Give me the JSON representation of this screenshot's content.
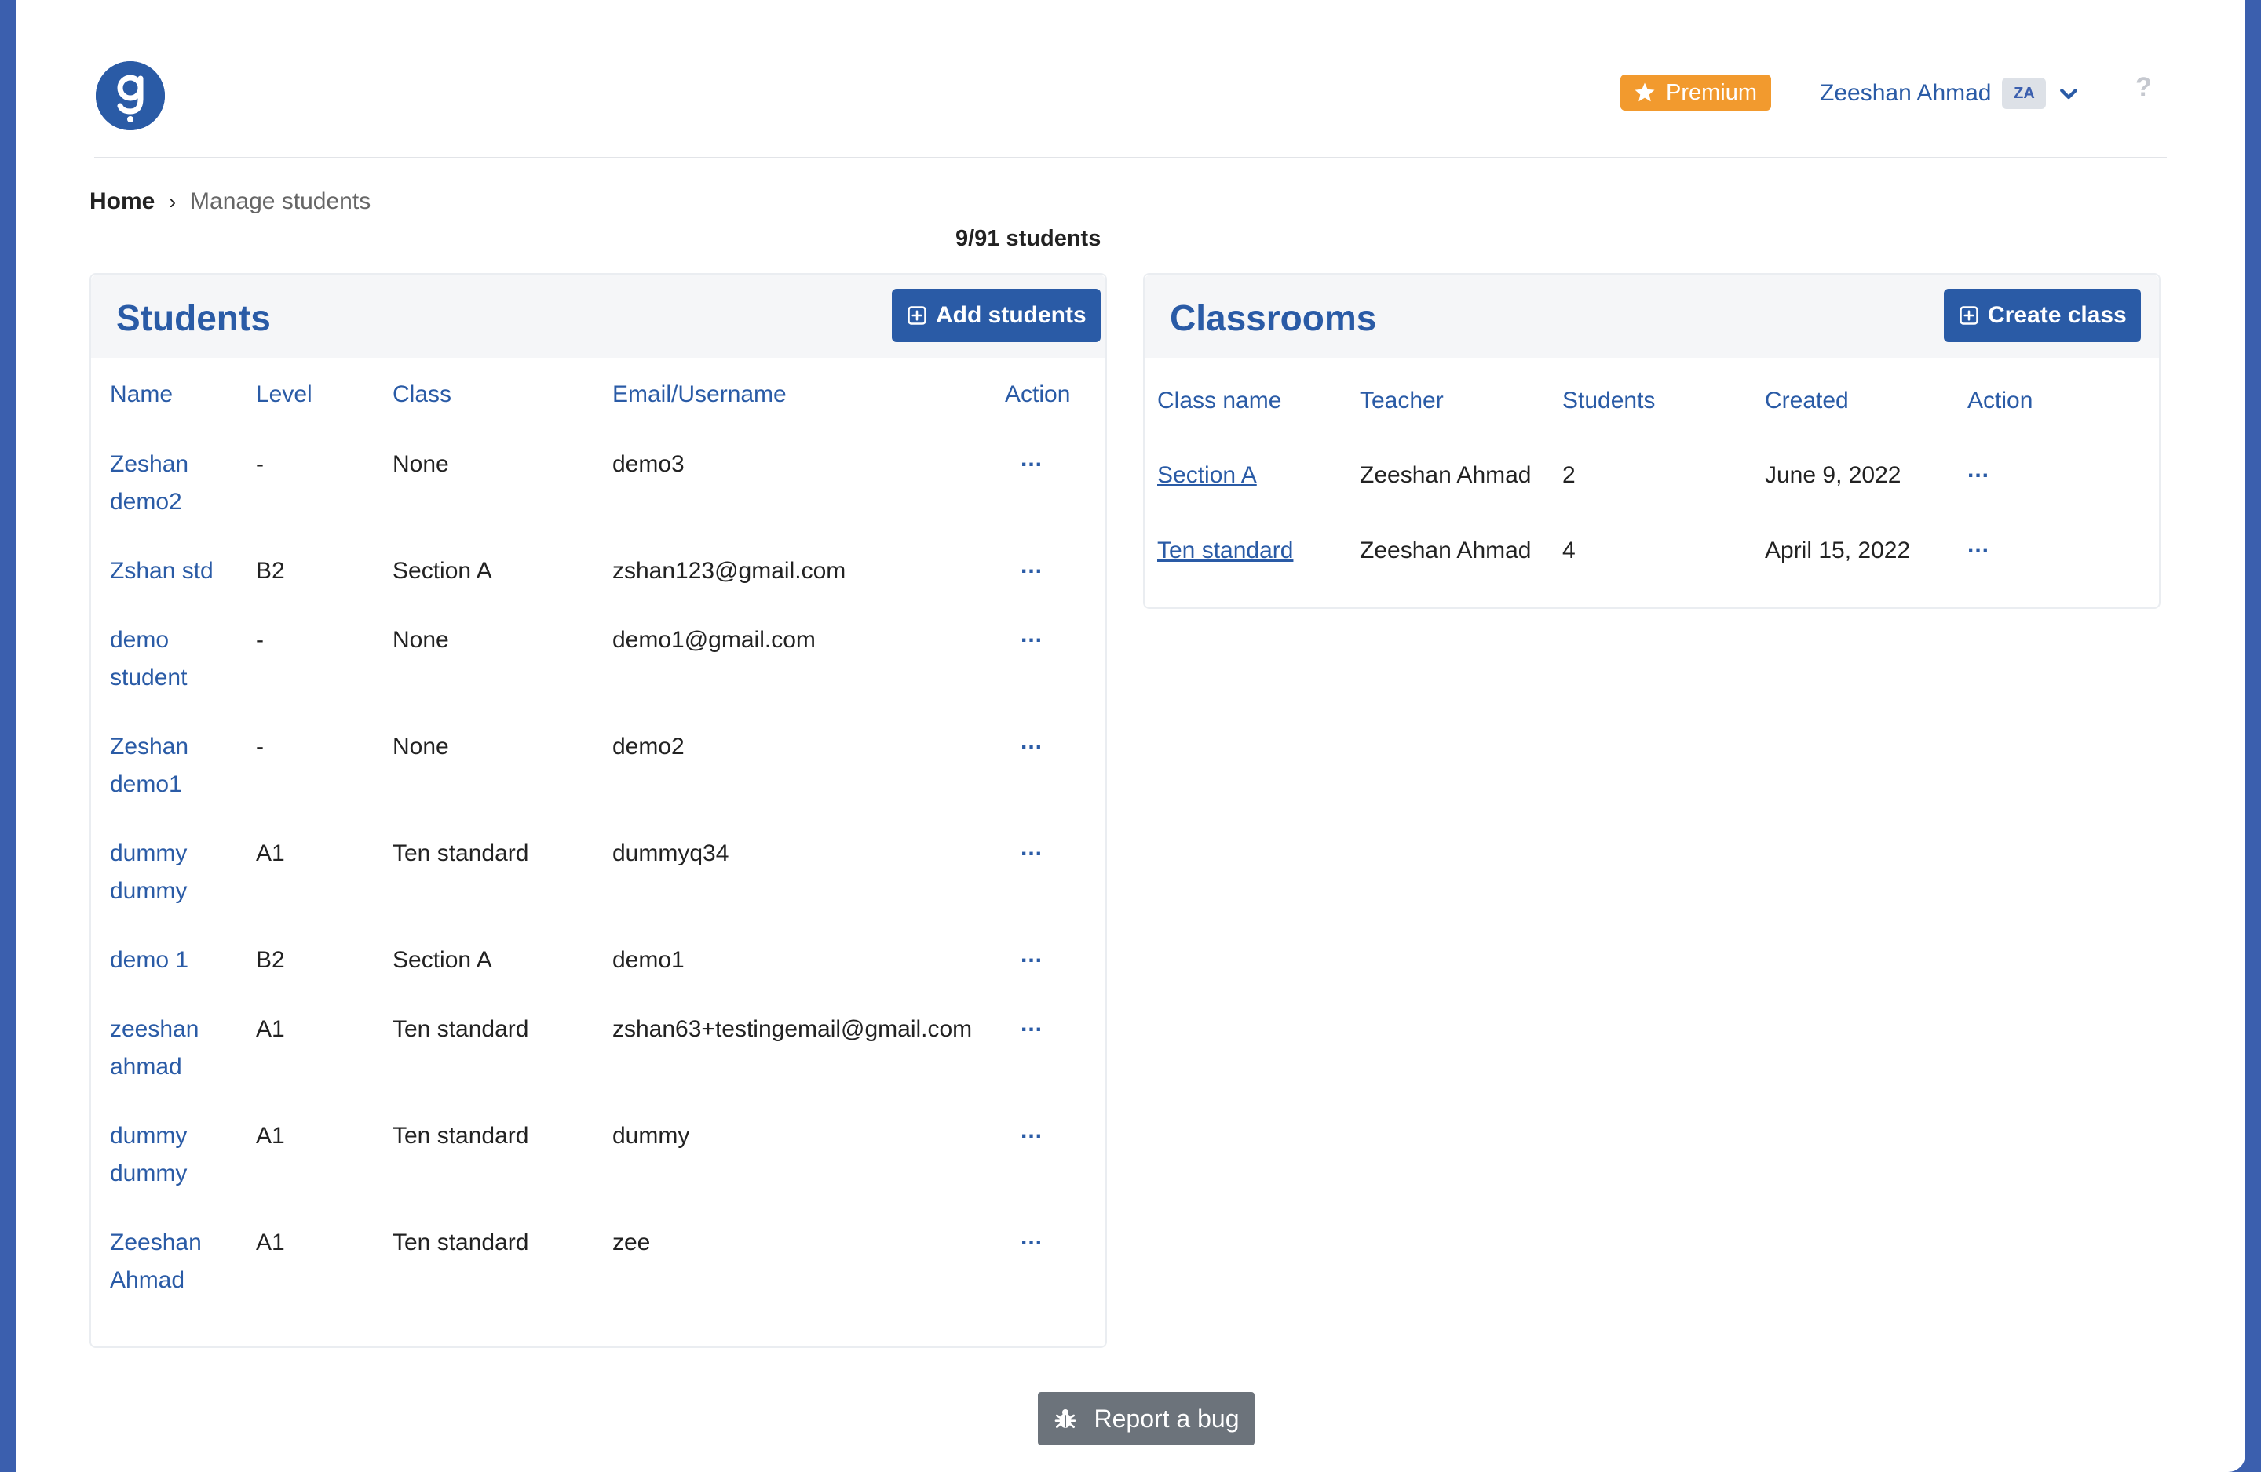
{
  "header": {
    "premium_label": "Premium",
    "user_name": "Zeeshan Ahmad",
    "user_initials": "ZA",
    "help_symbol": "?"
  },
  "breadcrumb": {
    "home": "Home",
    "current": "Manage students"
  },
  "student_count": "9/91 students",
  "students_panel": {
    "title": "Students",
    "add_button": "Add students",
    "columns": [
      "Name",
      "Level",
      "Class",
      "Email/Username",
      "Action"
    ],
    "rows": [
      {
        "name_line1": "Zeshan",
        "name_line2": "demo2",
        "level": "-",
        "class": "None",
        "email": "demo3",
        "action": "..."
      },
      {
        "name_line1": "Zshan std",
        "name_line2": "",
        "level": "B2",
        "class": "Section A",
        "email": "zshan123@gmail.com",
        "action": "..."
      },
      {
        "name_line1": "demo",
        "name_line2": "student",
        "level": "-",
        "class": "None",
        "email": "demo1@gmail.com",
        "action": "..."
      },
      {
        "name_line1": "Zeshan",
        "name_line2": "demo1",
        "level": "-",
        "class": "None",
        "email": "demo2",
        "action": "..."
      },
      {
        "name_line1": "dummy",
        "name_line2": "dummy",
        "level": "A1",
        "class": "Ten standard",
        "email": "dummyq34",
        "action": "..."
      },
      {
        "name_line1": "demo 1",
        "name_line2": "",
        "level": "B2",
        "class": "Section A",
        "email": "demo1",
        "action": "..."
      },
      {
        "name_line1": "zeeshan",
        "name_line2": "ahmad",
        "level": "A1",
        "class": "Ten standard",
        "email": "zshan63+testingemail@gmail.com",
        "action": "..."
      },
      {
        "name_line1": "dummy",
        "name_line2": "dummy",
        "level": "A1",
        "class": "Ten standard",
        "email": "dummy",
        "action": "..."
      },
      {
        "name_line1": "Zeeshan",
        "name_line2": "Ahmad",
        "level": "A1",
        "class": "Ten standard",
        "email": "zee",
        "action": "..."
      }
    ]
  },
  "classrooms_panel": {
    "title": "Classrooms",
    "create_button": "Create class",
    "columns": [
      "Class name",
      "Teacher",
      "Students",
      "Created",
      "Action"
    ],
    "rows": [
      {
        "class_name": "Section A",
        "teacher": "Zeeshan Ahmad",
        "students": "2",
        "created": "June 9, 2022",
        "action": "..."
      },
      {
        "class_name": "Ten standard",
        "teacher": "Zeeshan Ahmad",
        "students": "4",
        "created": "April 15, 2022",
        "action": "..."
      }
    ]
  },
  "footer": {
    "report_bug": "Report a bug"
  },
  "colors": {
    "brand_blue": "#2a5ba6",
    "premium_orange": "#f29a2e",
    "bug_button_gray": "#6c737b"
  }
}
